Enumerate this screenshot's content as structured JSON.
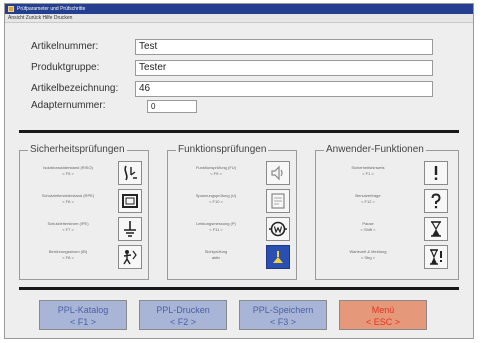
{
  "window": {
    "title": "Prüfparameter und Prüfschritte",
    "menu": "Ansicht Zurück Hilfe Drucken"
  },
  "fields": {
    "article_number": {
      "label": "Artikelnummer:",
      "value": "Test"
    },
    "product_group": {
      "label": "Produktgruppe:",
      "value": "Tester"
    },
    "article_description": {
      "label": "Artikelbezeichnung:",
      "value": "46"
    },
    "adapter_number": {
      "label": "Adapternummer:",
      "value": "0"
    }
  },
  "groups": {
    "safety": {
      "title": "Sicherheitsprüfungen",
      "rows": [
        {
          "text": "Isolationswiderstand (RISO)",
          "key": "< F5 >",
          "icon": "insulation-icon"
        },
        {
          "text": "Schutzleiterwiderstand (RPE)",
          "key": "< F6 >",
          "icon": "device-frame-icon"
        },
        {
          "text": "Schutzleiterstrom (IPE)",
          "key": "< F7 >",
          "icon": "earth-ground-icon"
        },
        {
          "text": "Berührungsstrom (IB)",
          "key": "< F8 >",
          "icon": "touch-current-icon"
        }
      ]
    },
    "function": {
      "title": "Funktionsprüfungen",
      "rows": [
        {
          "text": "Funktionsprüfung (FU)",
          "key": "< F9 >",
          "icon": "speaker-icon"
        },
        {
          "text": "Spannungsprüfung (U)",
          "key": "< F10 >",
          "icon": "document-check-icon"
        },
        {
          "text": "Leistungsmessung (P)",
          "key": "< F11 >",
          "icon": "watt-meter-icon"
        },
        {
          "text": "Sichtprüfung",
          "key": "aktiv",
          "icon": "visual-inspection-icon"
        }
      ]
    },
    "user": {
      "title": "Anwender-Funktionen",
      "rows": [
        {
          "text": "Sicherheitshinweis",
          "key": "< F1 >",
          "icon": "exclamation-icon"
        },
        {
          "text": "Benutzerfrage",
          "key": "< F12 >",
          "icon": "question-icon"
        },
        {
          "text": "Pause",
          "key": "< Shift >",
          "icon": "hourglass-icon"
        },
        {
          "text": "Wartezeit & Meldung",
          "key": "< Strg >",
          "icon": "hourglass-warning-icon"
        }
      ]
    }
  },
  "footer": {
    "catalog": {
      "label": "PPL-Katalog",
      "key": "< F1 >"
    },
    "print": {
      "label": "PPL-Drucken",
      "key": "< F2 >"
    },
    "save": {
      "label": "PPL-Speichern",
      "key": "< F3 >"
    },
    "menu": {
      "label": "Menü",
      "key": "< ESC >"
    }
  },
  "colors": {
    "titlebar": "#243f8f",
    "button_blue": "#a9b5d6",
    "button_red": "#e6987a",
    "active_icon": "#2a4fb0"
  }
}
